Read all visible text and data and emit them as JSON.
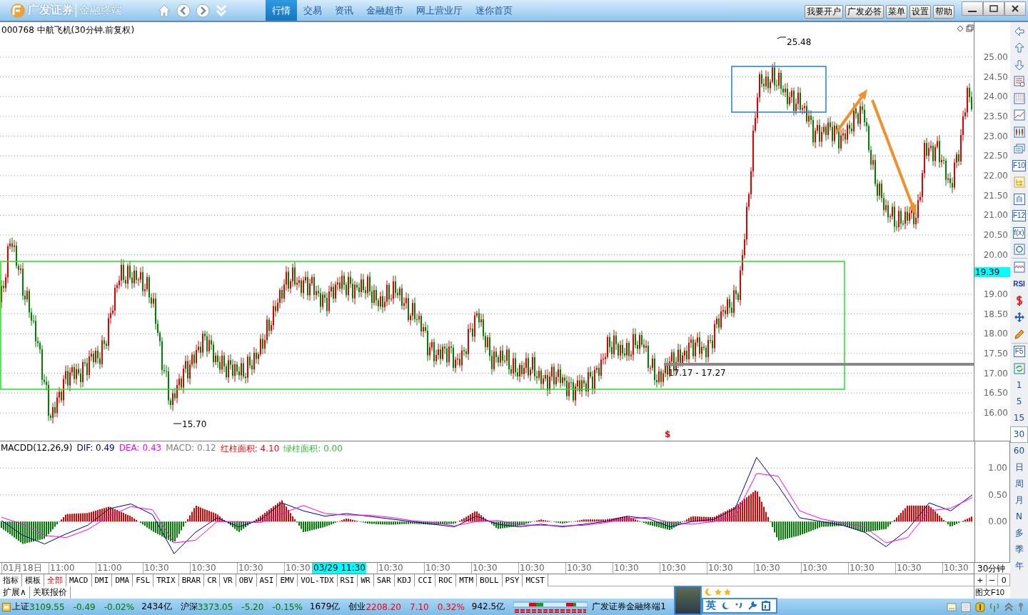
{
  "app": {
    "logo_text": "广发证券",
    "logo_subtext": "金融终端"
  },
  "nav_tabs": [
    {
      "label": "行情",
      "selected": true
    },
    {
      "label": "交易",
      "selected": false
    },
    {
      "label": "资讯",
      "selected": false
    },
    {
      "label": "金融超市",
      "selected": false
    },
    {
      "label": "网上营业厅",
      "selected": false
    },
    {
      "label": "迷你首页",
      "selected": false
    }
  ],
  "top_buttons": [
    "我要开户",
    "广发必答",
    "菜单",
    "设置",
    "帮助"
  ],
  "chart": {
    "title": "000768 中航飞机(30分钟.前复权)",
    "annotations": [
      "25.48",
      "15.70",
      "17.17 - 17.27"
    ],
    "marker": "$",
    "price_ticks": [
      "25.00",
      "24.50",
      "24.00",
      "23.50",
      "23.00",
      "22.50",
      "22.00",
      "21.50",
      "21.00",
      "20.50",
      "20.00",
      "19.00",
      "18.50",
      "18.00",
      "17.50",
      "17.00",
      "16.50",
      "16.00"
    ],
    "current_price": "19.39"
  },
  "macd": {
    "title": "MACDD(12,26,9)",
    "series_readings": [
      "0.49",
      "0.43"
    ],
    "chart_data": {
      "type": "line",
      "grid": true,
      "ylim": [
        -0.76,
        1.5
      ],
      "yticks": [
        {
          "value": 0,
          "label": "0.00"
        },
        {
          "value": 0.5,
          "label": "0.50"
        },
        {
          "value": 1,
          "label": "1.00"
        }
      ],
      "series": [
        {
          "name": "DIF:",
          "color": "#000080",
          "values": [
            0.02,
            -0.26,
            -0.42,
            -0.23,
            -0.07,
            0.24,
            0.33,
            0.13,
            -0.6,
            -0.2,
            0.07,
            -0.1,
            0.03,
            0.35,
            0.2,
            0.1,
            0.15,
            0.1,
            0.05,
            0.0,
            -0.05,
            -0.1,
            0.1,
            -0.05,
            -0.1,
            -0.05,
            -0.1,
            -0.05,
            0.0,
            0.1,
            0.05,
            -0.1,
            0.0,
            0.04,
            0.24,
            1.2,
            0.67,
            0.07,
            0.0,
            -0.07,
            -0.2,
            -0.47,
            -0.15,
            0.35,
            0.2,
            0.5
          ]
        },
        {
          "name": "DEA:",
          "color": "#ff00ff",
          "values": [
            0.08,
            -0.05,
            -0.26,
            -0.3,
            -0.15,
            0.1,
            0.28,
            0.22,
            -0.4,
            -0.35,
            0.0,
            0.0,
            -0.02,
            0.15,
            0.3,
            0.15,
            0.12,
            0.12,
            0.08,
            0.02,
            -0.02,
            -0.08,
            0.0,
            0.02,
            -0.06,
            -0.07,
            -0.08,
            -0.07,
            -0.02,
            0.05,
            0.08,
            -0.02,
            -0.05,
            0.0,
            0.1,
            0.9,
            0.85,
            0.2,
            0.05,
            -0.03,
            -0.1,
            -0.4,
            -0.3,
            0.2,
            0.25,
            0.45
          ]
        }
      ]
    },
    "readings": [
      {
        "text": "MACD: 0.12",
        "color": "#808080"
      },
      {
        "text": "红柱面积: 4.10",
        "color": "#ff0000"
      },
      {
        "text": "绿柱面积: 0.00",
        "color": "#33bb33"
      }
    ]
  },
  "time_axis": {
    "labels": [
      {
        "text": "01月18日",
        "selected": false
      },
      {
        "text": "11:00",
        "selected": false
      },
      {
        "text": "11:00",
        "selected": false
      },
      {
        "text": "10:30",
        "selected": false
      },
      {
        "text": "10:30",
        "selected": false
      },
      {
        "text": "10:30",
        "selected": false
      },
      {
        "text": "10:30",
        "selected": false
      },
      {
        "text": "03/29 11:30",
        "selected": true
      },
      {
        "text": "10:30",
        "selected": false
      },
      {
        "text": "10:30",
        "selected": false
      },
      {
        "text": "10:30",
        "selected": false
      },
      {
        "text": "10:30",
        "selected": false
      },
      {
        "text": "10:30",
        "selected": false
      },
      {
        "text": "10:30",
        "selected": false
      },
      {
        "text": "10:30",
        "selected": false
      },
      {
        "text": "10:30",
        "selected": false
      },
      {
        "text": "10:30",
        "selected": false
      },
      {
        "text": "10:30",
        "selected": false
      },
      {
        "text": "10:30",
        "selected": false
      },
      {
        "text": "10:30",
        "selected": false
      },
      {
        "text": "10:30",
        "selected": false
      }
    ],
    "period": "30分钟"
  },
  "indicator_tabs": [
    {
      "label": "指标",
      "selected": false
    },
    {
      "label": "模板",
      "selected": false
    },
    {
      "label": "全部",
      "selected": true
    },
    {
      "label": "MACD",
      "selected": false
    },
    {
      "label": "DMI",
      "selected": false
    },
    {
      "label": "DMA",
      "selected": false
    },
    {
      "label": "FSL",
      "selected": false
    },
    {
      "label": "TRIX",
      "selected": false
    },
    {
      "label": "BRAR",
      "selected": false
    },
    {
      "label": "CR",
      "selected": false
    },
    {
      "label": "VR",
      "selected": false
    },
    {
      "label": "OBV",
      "selected": false
    },
    {
      "label": "ASI",
      "selected": false
    },
    {
      "label": "EMV",
      "selected": false
    },
    {
      "label": "VOL-TDX",
      "selected": false
    },
    {
      "label": "RSI",
      "selected": false
    },
    {
      "label": "WR",
      "selected": false
    },
    {
      "label": "SAR",
      "selected": false
    },
    {
      "label": "KDJ",
      "selected": false
    },
    {
      "label": "CCI",
      "selected": false
    },
    {
      "label": "ROC",
      "selected": false
    },
    {
      "label": "MTM",
      "selected": false
    },
    {
      "label": "BOLL",
      "selected": false
    },
    {
      "label": "PSY",
      "selected": false
    },
    {
      "label": "MCST",
      "selected": false
    }
  ],
  "extra_tabs": [
    "扩展∧",
    "关联报价"
  ],
  "zoom_buttons": [
    "+",
    "−",
    "0"
  ],
  "f10_button": "图文F10",
  "side_toolbar": {
    "tools": [
      {
        "kind": "left"
      },
      {
        "kind": "up"
      },
      {
        "kind": "down"
      },
      {
        "kind": "table"
      },
      {
        "kind": "grid"
      },
      {
        "kind": "line"
      },
      {
        "kind": "candle"
      },
      {
        "kind": "windows"
      },
      {
        "kind": "label",
        "label": "F10"
      },
      {
        "kind": "tree"
      },
      {
        "kind": "label",
        "label": "自"
      },
      {
        "kind": "label",
        "label": "F12"
      },
      {
        "kind": "label",
        "label": "f(x)"
      },
      {
        "kind": "circle"
      },
      {
        "kind": "wave"
      },
      {
        "kind": "text",
        "label": "RSI"
      },
      {
        "kind": "dollar"
      },
      {
        "kind": "move"
      },
      {
        "kind": "pencil"
      },
      {
        "kind": "label",
        "label": "F5"
      },
      {
        "kind": "refresh"
      }
    ],
    "periods": [
      {
        "label": "1",
        "selected": false
      },
      {
        "label": "5",
        "selected": false
      },
      {
        "label": "15",
        "selected": false
      },
      {
        "label": "30",
        "selected": true
      },
      {
        "label": "60",
        "selected": false
      },
      {
        "label": "日",
        "selected": false
      },
      {
        "label": "周",
        "selected": false
      },
      {
        "label": "月",
        "selected": false
      },
      {
        "label": "N",
        "selected": false
      },
      {
        "label": "多",
        "selected": false
      },
      {
        "label": "季",
        "selected": false
      },
      {
        "label": "年",
        "selected": false
      }
    ]
  },
  "status_bar": {
    "indices": [
      {
        "name": "上证",
        "value": "3109.55",
        "change": "-0.49",
        "percent": "-0.02%",
        "volume": "2434亿",
        "color": "#007a00"
      },
      {
        "name": "沪深",
        "value": "3373.05",
        "change": "-5.20",
        "percent": "-0.15%",
        "volume": "1679亿",
        "color": "#007a00"
      },
      {
        "name": "创业",
        "value": "2208.20",
        "change": "7.10",
        "percent": "0.32%",
        "volume": "942.5亿",
        "color": "#ff0000"
      }
    ],
    "app_label": "广发证券金融终端1"
  },
  "ime": {
    "mode": "英"
  }
}
